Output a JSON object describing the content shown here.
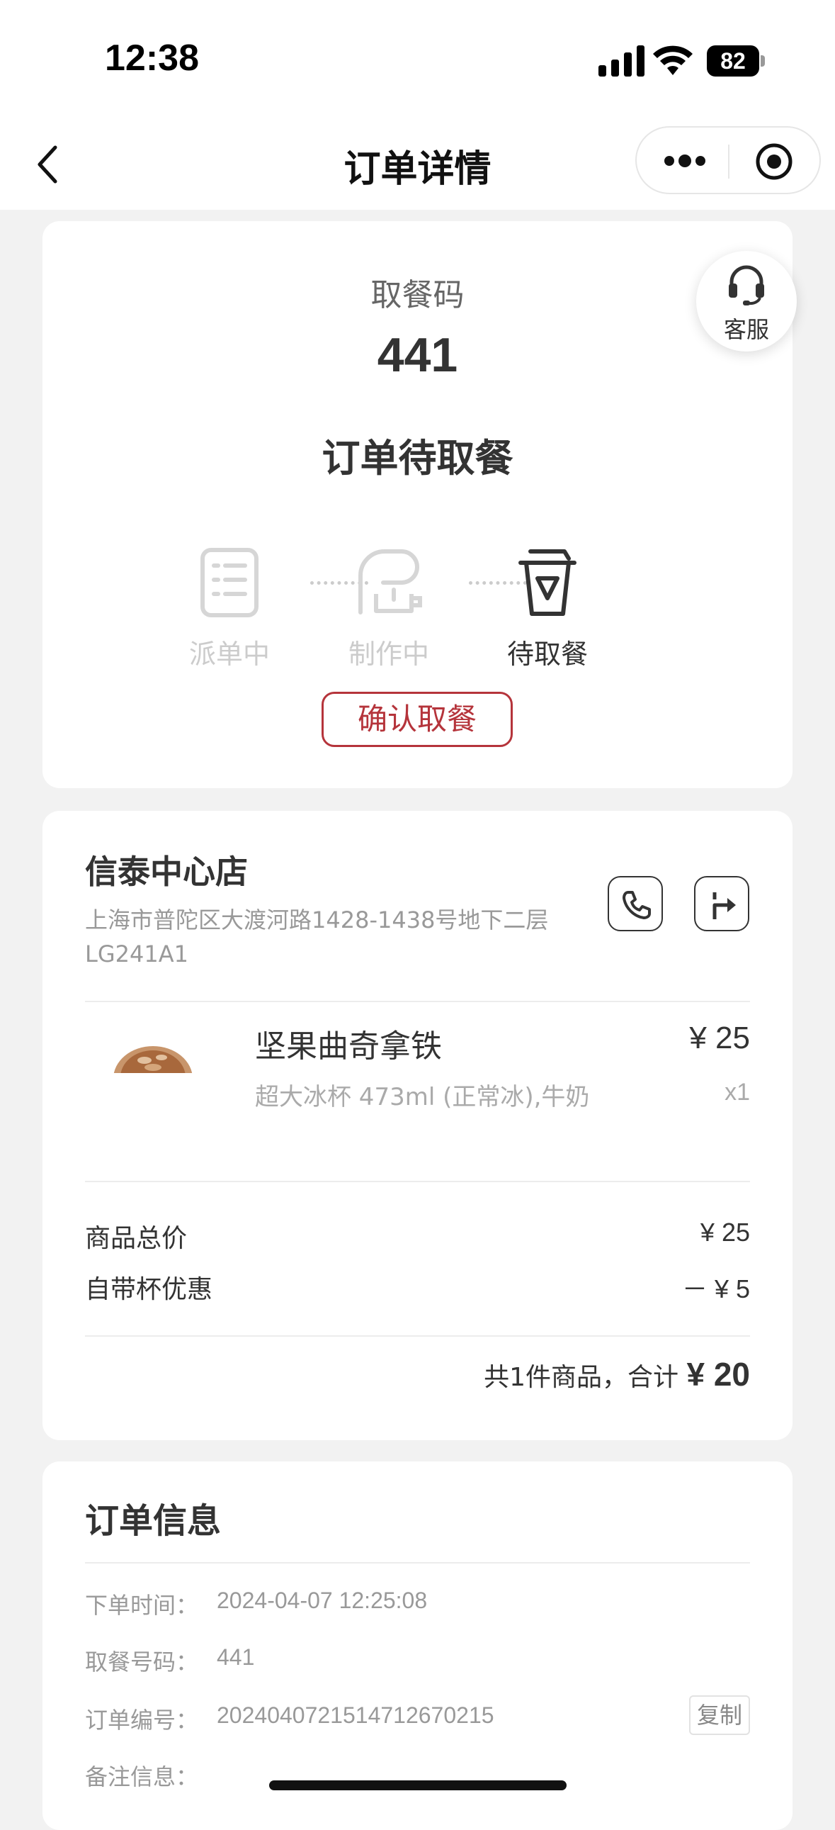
{
  "status_bar": {
    "time": "12:38",
    "battery": "82"
  },
  "nav": {
    "title": "订单详情"
  },
  "customer_service": {
    "label": "客服"
  },
  "pickup": {
    "label": "取餐码",
    "code": "441",
    "status": "订单待取餐",
    "steps": [
      {
        "label": "派单中",
        "active": false
      },
      {
        "label": "制作中",
        "active": false
      },
      {
        "label": "待取餐",
        "active": true
      }
    ],
    "confirm_label": "确认取餐",
    "accent_color": "#b5343b"
  },
  "store": {
    "name": "信泰中心店",
    "address": "上海市普陀区大渡河路1428-1438号地下二层LG241A1"
  },
  "product": {
    "name": "坚果曲奇拿铁",
    "spec": "超大冰杯 473ml (正常冰),牛奶",
    "price": "¥ 25",
    "qty": "x1"
  },
  "summary": {
    "subtotal_label": "商品总价",
    "subtotal_value": "¥ 25",
    "discount_label": "自带杯优惠",
    "discount_value": "－ ¥ 5",
    "total_prefix": "共1件商品，合计 ",
    "total_value": "¥ 20"
  },
  "order_info": {
    "title": "订单信息",
    "order_time_label": "下单时间：",
    "order_time": "2024-04-07 12:25:08",
    "pickup_no_label": "取餐号码：",
    "pickup_no": "441",
    "order_no_label": "订单编号：",
    "order_no": "20240407215147126702​15",
    "copy_label": "复制",
    "remark_label": "备注信息："
  }
}
